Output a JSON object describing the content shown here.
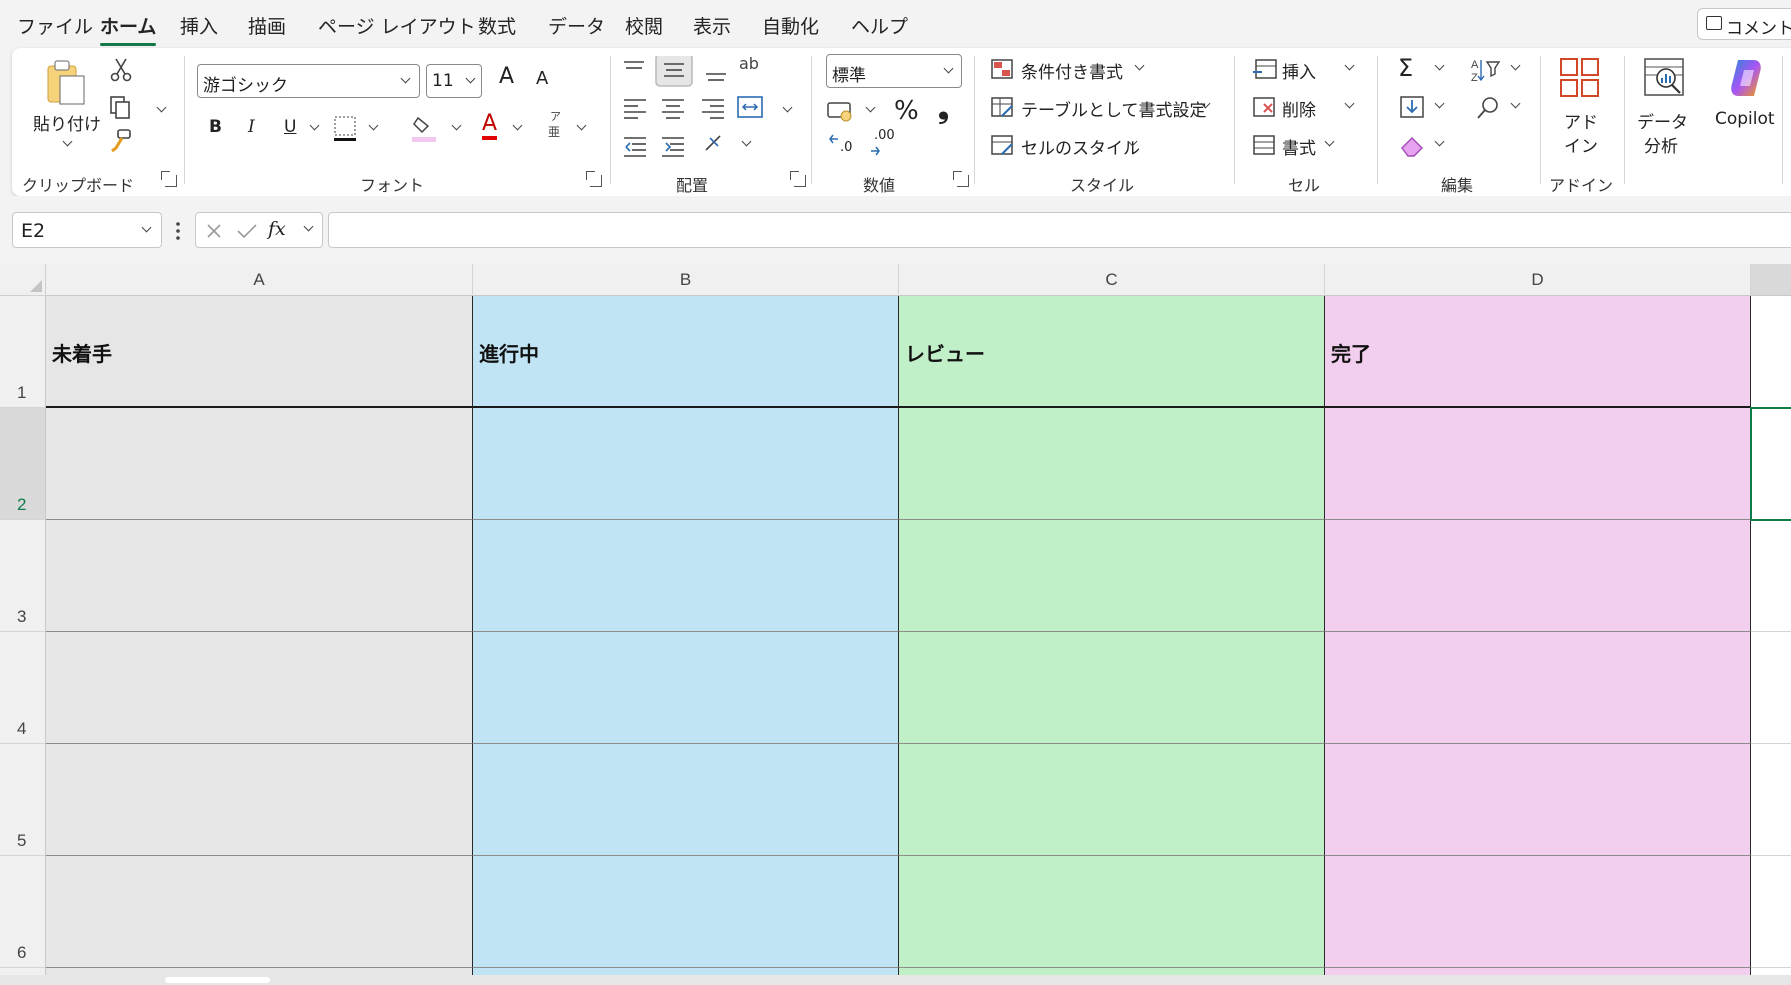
{
  "menu": {
    "tabs": [
      "ファイル",
      "ホーム",
      "挿入",
      "描画",
      "ページ レイアウト",
      "数式",
      "データ",
      "校閲",
      "表示",
      "自動化",
      "ヘルプ"
    ],
    "active": "ホーム",
    "comment_label": "コメント"
  },
  "ribbon": {
    "clipboard": {
      "paste": "貼り付け",
      "label": "クリップボード"
    },
    "font": {
      "name": "游ゴシック",
      "size": "11",
      "bold": "B",
      "italic": "I",
      "underline": "U",
      "grow": "A",
      "shrink": "A",
      "color_glyph": "A",
      "phonetic_top": "ア",
      "phonetic_bottom": "亜",
      "label": "フォント",
      "font_color": "#e00000",
      "fill_color": "#f2c8f0"
    },
    "alignment": {
      "wrap": "ab",
      "label": "配置"
    },
    "number": {
      "format": "標準",
      "percent": "%",
      "comma": "❟",
      "inc_decimal": ".0",
      "dec_decimal": ".00",
      "label": "数値"
    },
    "styles": {
      "conditional": "条件付き書式",
      "table": "テーブルとして書式設定",
      "cell_styles": "セルのスタイル",
      "label": "スタイル"
    },
    "cells": {
      "insert": "挿入",
      "delete": "削除",
      "format": "書式",
      "label": "セル"
    },
    "editing": {
      "sum": "Σ",
      "label": "編集"
    },
    "addins": {
      "addin_line1": "アド",
      "addin_line2": "イン",
      "label": "アドイン"
    },
    "analysis": {
      "line1": "データ",
      "line2": "分析"
    },
    "copilot": {
      "label": "Copilot"
    }
  },
  "formula_bar": {
    "name_box": "E2",
    "fx": "fx",
    "content": ""
  },
  "sheet": {
    "columns": [
      "A",
      "B",
      "C",
      "D"
    ],
    "rows": [
      "1",
      "2",
      "3",
      "4",
      "5",
      "6"
    ],
    "headers": [
      "未着手",
      "進行中",
      "レビュー",
      "完了"
    ],
    "column_colors": [
      "#e6e6e6",
      "#c0e4f4",
      "#c1f0c8",
      "#f2ceef"
    ],
    "selected_cell": "E2",
    "accent": "#117a49"
  }
}
